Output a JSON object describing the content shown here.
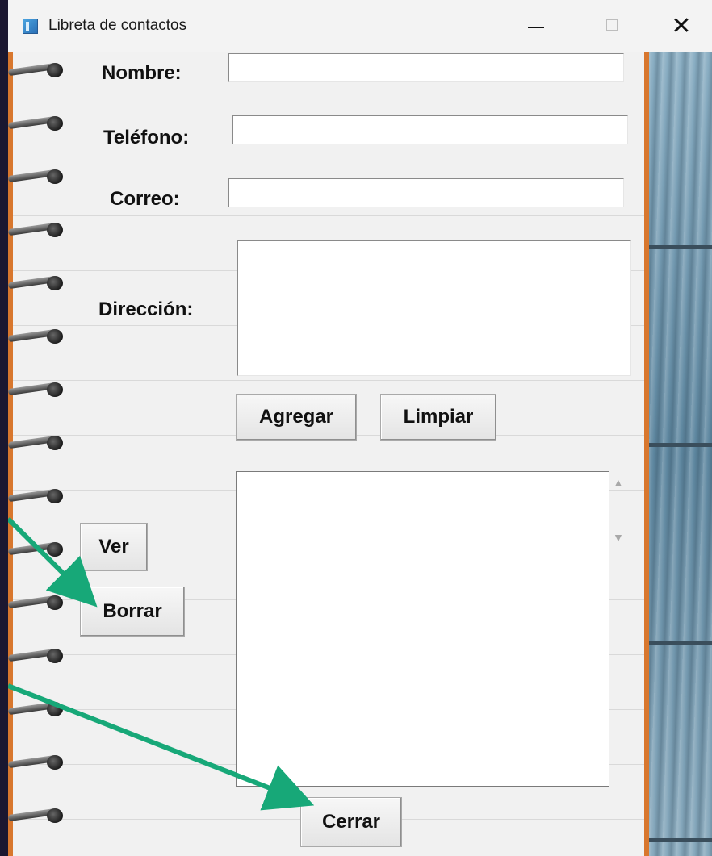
{
  "window": {
    "title": "Libreta de contactos",
    "controls": {
      "minimize": "minimize-icon",
      "maximize": "maximize-icon",
      "close": "✕"
    }
  },
  "form": {
    "name_label": "Nombre:",
    "name_value": "",
    "phone_label": "Teléfono:",
    "phone_value": "",
    "email_label": "Correo:",
    "email_value": "",
    "address_label": "Dirección:",
    "address_value": ""
  },
  "buttons": {
    "add": "Agregar",
    "clear": "Limpiar",
    "view": "Ver",
    "delete": "Borrar",
    "close": "Cerrar"
  },
  "list": {
    "items": []
  },
  "colors": {
    "page_background": "#f1f1f1",
    "binding_edge": "#d8772e",
    "annotation_arrow": "#17a878",
    "wood": "#6d94ad"
  }
}
